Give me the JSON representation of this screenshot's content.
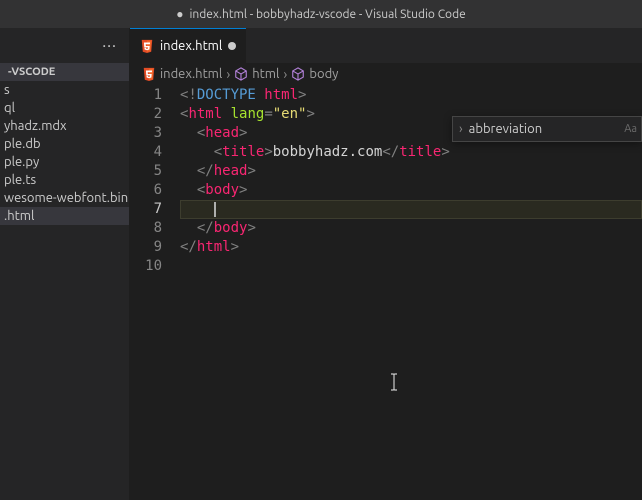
{
  "title": {
    "dot": "●",
    "text": "index.html - bobbyhadz-vscode - Visual Studio Code"
  },
  "sidebar": {
    "header": "-VSCODE",
    "items": [
      {
        "label": "s"
      },
      {
        "label": "ql"
      },
      {
        "label": "yhadz.mdx"
      },
      {
        "label": "ple.db"
      },
      {
        "label": "ple.py"
      },
      {
        "label": "ple.ts"
      },
      {
        "label": "wesome-webfont.bin"
      },
      {
        "label": ".html"
      }
    ],
    "selectedIndex": 7
  },
  "tab": {
    "label": "index.html",
    "modified": true
  },
  "breadcrumbs": {
    "file": "index.html",
    "path": [
      "html",
      "body"
    ]
  },
  "code": {
    "lines": [
      "1",
      "2",
      "3",
      "4",
      "5",
      "6",
      "7",
      "8",
      "9",
      "10"
    ],
    "currentLine": 7,
    "l1": {
      "a": "<!",
      "b": "DOCTYPE ",
      "c": "html",
      "d": ">"
    },
    "l2": {
      "a": "<",
      "b": "html ",
      "c": "lang",
      "d": "=",
      "e": "\"en\"",
      "f": ">"
    },
    "l3": {
      "a": "  <",
      "b": "head",
      "c": ">"
    },
    "l4": {
      "a": "    <",
      "b": "title",
      "c": ">",
      "d": "bobbyhadz.com",
      "e": "</",
      "f": "title",
      "g": ">"
    },
    "l5": {
      "a": "  </",
      "b": "head",
      "c": ">"
    },
    "l6": {
      "a": "  <",
      "b": "body",
      "c": ">"
    },
    "l7": {
      "a": "    "
    },
    "l8": {
      "a": "  </",
      "b": "body",
      "c": ">"
    },
    "l9": {
      "a": "</",
      "b": "html",
      "c": ">"
    }
  },
  "autocomplete": {
    "label": "abbreviation",
    "hint": "Aa"
  }
}
